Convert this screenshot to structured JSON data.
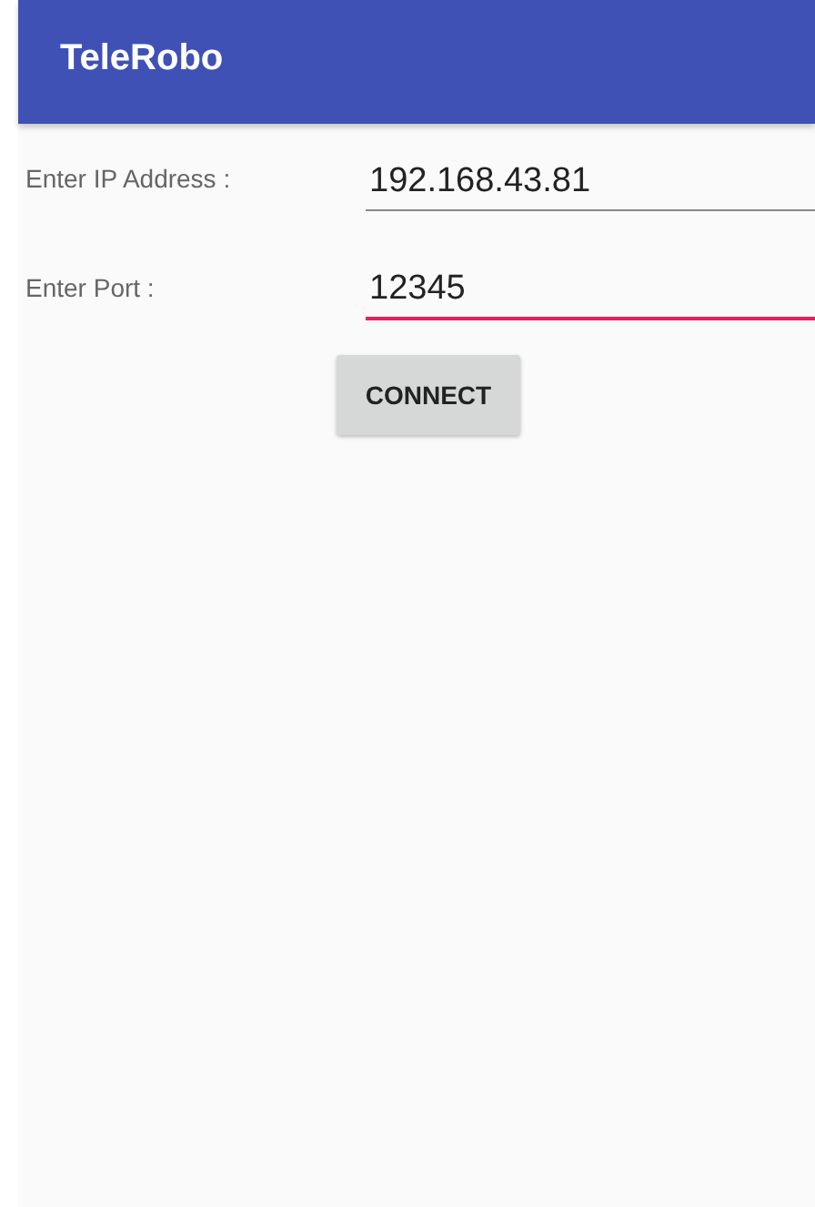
{
  "app_bar": {
    "title": "TeleRobo"
  },
  "fields": [
    {
      "label": "Enter IP Address :",
      "value": "192.168.43.81",
      "focused": false
    },
    {
      "label": "Enter Port :",
      "value": "12345",
      "focused": true
    }
  ],
  "button": {
    "label": "CONNECT"
  }
}
